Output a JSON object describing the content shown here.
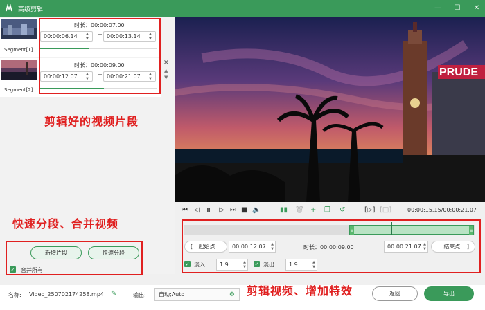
{
  "window": {
    "title": "高级剪辑"
  },
  "segments": [
    {
      "label": "Segment[1]",
      "duration": "时长：00:00:07.00",
      "start": "00:00:06.14",
      "end": "00:00:13.14",
      "progress": 0.42
    },
    {
      "label": "Segment[2]",
      "duration": "时长：00:00:09.00",
      "start": "00:00:12.07",
      "end": "00:00:21.07",
      "progress": 0.55
    }
  ],
  "annotations": {
    "segments_note": "剪辑好的视频片段",
    "split_note": "快速分段、合并视频",
    "edit_note": "剪辑视频、增加特效"
  },
  "left_actions": {
    "new_segment": "新增片段",
    "quick_split": "快速分段",
    "merge_all": "合并所有"
  },
  "video": {
    "sign_text": "PRUDE"
  },
  "player": {
    "time": "00:00:15.15/00:00:21.07"
  },
  "trim": {
    "start_btn": "起始点",
    "start_time": "00:00:12.07",
    "duration": "时长：00:00:09.00",
    "end_time": "00:00:21.07",
    "end_btn": "结束点",
    "fade_in_label": "淡入",
    "fade_in_value": "1.9",
    "fade_out_label": "淡出",
    "fade_out_value": "1.9"
  },
  "bottom": {
    "name_label": "名称:",
    "file_name": "Video_250702174258.mp4",
    "output_label": "输出:",
    "output_value": "自动;Auto",
    "back": "返回",
    "export": "导出"
  },
  "colors": {
    "accent": "#3a9a5a",
    "annotation": "#e02020"
  }
}
